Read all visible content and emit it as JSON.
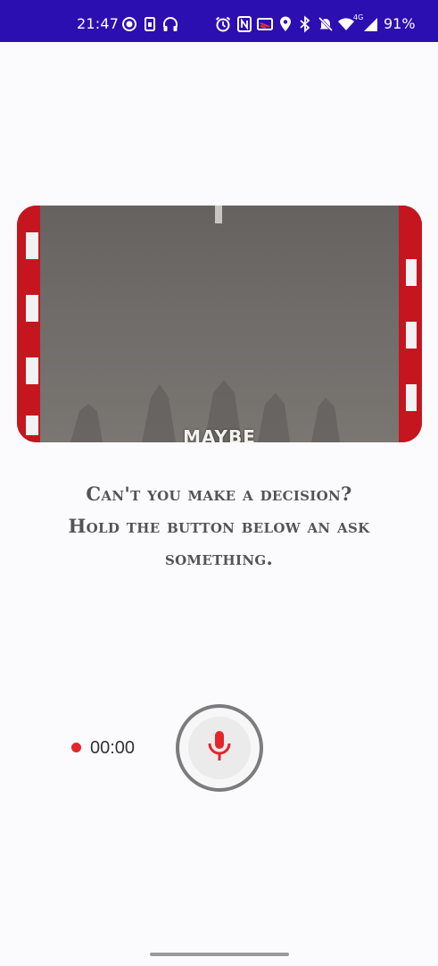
{
  "status_bar": {
    "time": "21:47",
    "battery": "91%",
    "network": "4G",
    "left_icons": [
      "record-icon",
      "sim-icon",
      "headset-icon"
    ],
    "right_icons": [
      "alarm-icon",
      "nfc-icon",
      "cast-icon",
      "location-icon",
      "bluetooth-icon",
      "mute-icon",
      "wifi-icon",
      "signal-icon",
      "battery-icon"
    ],
    "background": "#2b0fb0"
  },
  "media": {
    "caption": "MAYBE"
  },
  "prompt": {
    "line1": "Can't you make a decision?",
    "line2": "Hold the button below an ask",
    "line3": "something."
  },
  "recorder": {
    "timer": "00:00",
    "dot_color": "#e3262b",
    "mic_color": "#e3262b"
  }
}
